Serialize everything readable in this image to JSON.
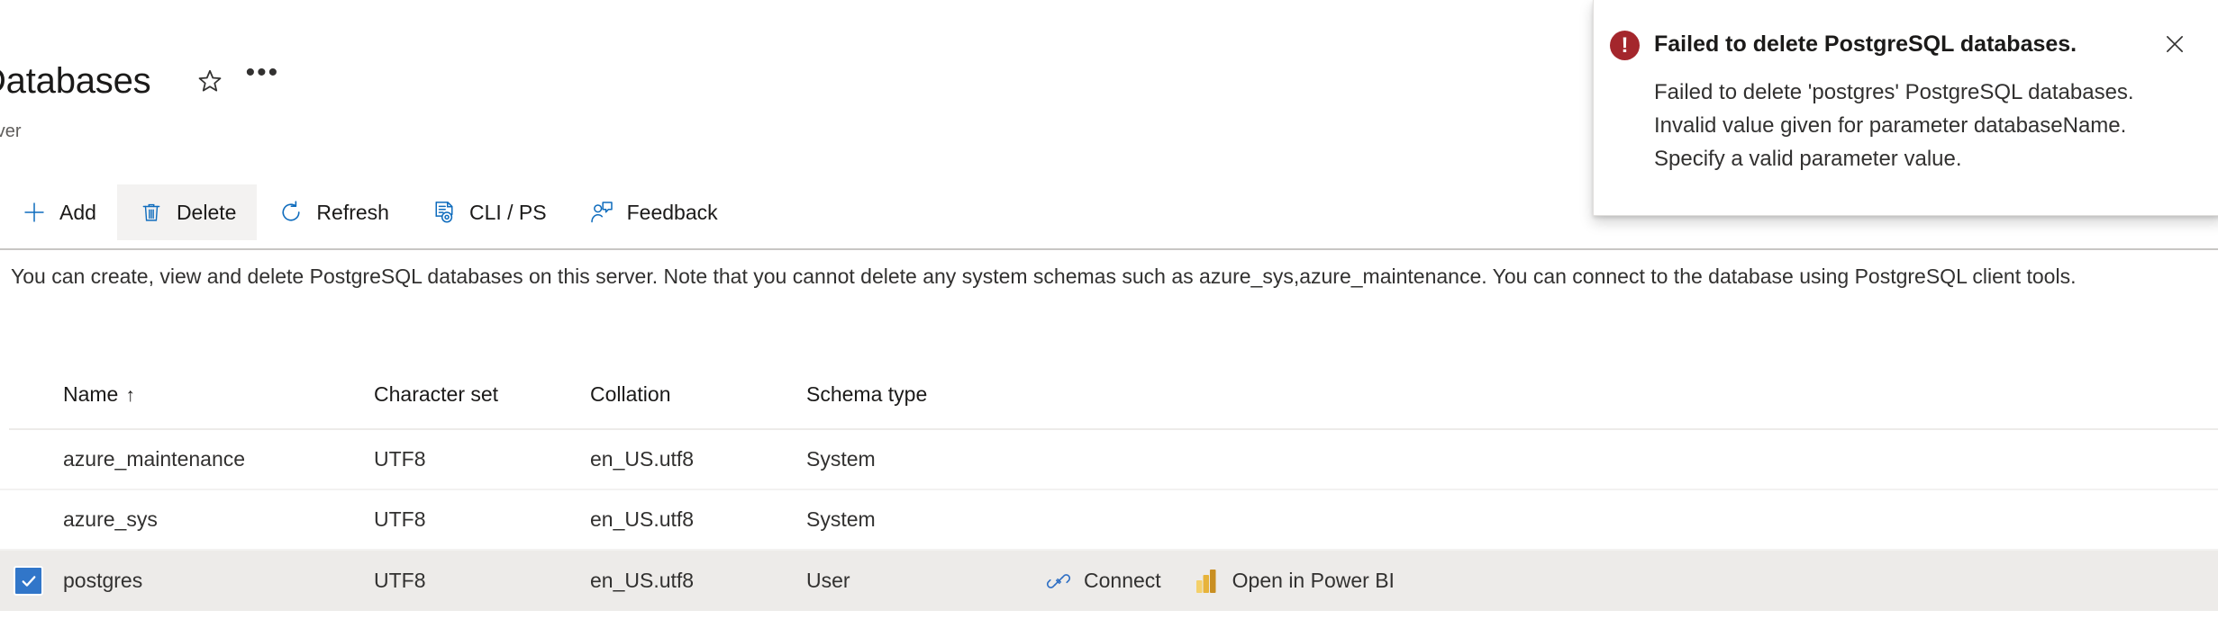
{
  "header": {
    "title": "Databases",
    "subtitle": "erver",
    "favorite_icon": "star-icon",
    "more_icon": "ellipsis-icon"
  },
  "toolbar": {
    "items": [
      {
        "label": "Add",
        "icon": "plus-icon",
        "active": false
      },
      {
        "label": "Delete",
        "icon": "trash-icon",
        "active": true
      },
      {
        "label": "Refresh",
        "icon": "refresh-icon",
        "active": false
      },
      {
        "label": "CLI / PS",
        "icon": "cli-ps-icon",
        "active": false
      },
      {
        "label": "Feedback",
        "icon": "feedback-icon",
        "active": false
      }
    ]
  },
  "description": "You can create, view and delete PostgreSQL databases on this server. Note that you cannot delete any system schemas such as azure_sys,azure_maintenance. You can connect to the database using PostgreSQL client tools.",
  "table": {
    "columns": [
      {
        "label": "Name",
        "sort": "↑"
      },
      {
        "label": "Character set",
        "sort": ""
      },
      {
        "label": "Collation",
        "sort": ""
      },
      {
        "label": "Schema type",
        "sort": ""
      }
    ],
    "rows": [
      {
        "selected": false,
        "name": "azure_maintenance",
        "charset": "UTF8",
        "collation": "en_US.utf8",
        "schema_type": "System",
        "actions": []
      },
      {
        "selected": false,
        "name": "azure_sys",
        "charset": "UTF8",
        "collation": "en_US.utf8",
        "schema_type": "System",
        "actions": []
      },
      {
        "selected": true,
        "name": "postgres",
        "charset": "UTF8",
        "collation": "en_US.utf8",
        "schema_type": "User",
        "actions": [
          {
            "label": "Connect",
            "icon": "plug-connect-icon"
          },
          {
            "label": "Open in Power BI",
            "icon": "power-bi-icon"
          }
        ]
      }
    ]
  },
  "notification": {
    "severity": "error",
    "icon": "error-exclamation-icon",
    "title": "Failed to delete PostgreSQL databases.",
    "message": "Failed to delete 'postgres' PostgreSQL databases. Invalid value given for parameter databaseName. Specify a valid parameter value.",
    "close_icon": "close-icon",
    "exclamation_glyph": "!"
  },
  "colors": {
    "accent_blue": "#0f6cbd",
    "checkbox_blue": "#3176c9",
    "error_red": "#a4262c",
    "row_selected": "#edebe9",
    "toolbar_active": "#f3f2f1",
    "powerbi_yellow": "#f2c811"
  }
}
